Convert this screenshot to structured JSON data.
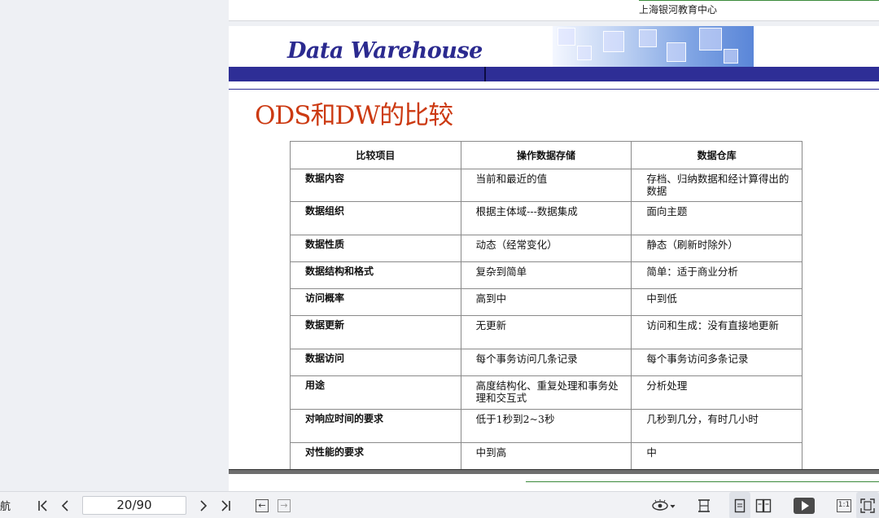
{
  "document": {
    "previous_page_footer": "上海银河教育中心"
  },
  "slide": {
    "banner_title": "Data Warehouse",
    "heading": "ODS和DW的比较",
    "table": {
      "headers": [
        "比较项目",
        "操作数据存储",
        "数据仓库"
      ],
      "rows": [
        [
          "数据内容",
          "当前和最近的值",
          "存档、归纳数据和经计算得出的数据"
        ],
        [
          "数据组织",
          "根据主体域---数据集成",
          "面向主题"
        ],
        [
          "数据性质",
          "动态（经常变化）",
          "静态（刷新时除外）"
        ],
        [
          "数据结构和格式",
          "复杂到简单",
          "简单：适于商业分析"
        ],
        [
          "访问概率",
          "高到中",
          "中到低"
        ],
        [
          "数据更新",
          "无更新",
          "访问和生成：没有直接地更新"
        ],
        [
          "数据访问",
          "每个事务访问几条记录",
          "每个事务访问多条记录"
        ],
        [
          "用途",
          "高度结构化、重复处理和事务处理和交互式",
          "分析处理"
        ],
        [
          "对响应时间的要求",
          "低于1秒到2~3秒",
          "几秒到几分，有时几小时"
        ],
        [
          "对性能的要求",
          "中到高",
          "中"
        ]
      ]
    }
  },
  "toolbar": {
    "nav_label": "航",
    "page_indicator": "20/90",
    "fit_ratio_label": "1:1",
    "icons": {
      "first": "first-page-icon",
      "prev": "prev-page-icon",
      "next": "next-page-icon",
      "last": "last-page-icon",
      "back": "back-icon",
      "forward": "forward-icon",
      "eye": "eye-mode-icon",
      "fit_width": "fit-width-icon",
      "single": "single-page-icon",
      "double": "double-page-icon",
      "play": "play-icon",
      "actual": "actual-size-icon",
      "fullscreen": "fit-page-icon"
    }
  }
}
